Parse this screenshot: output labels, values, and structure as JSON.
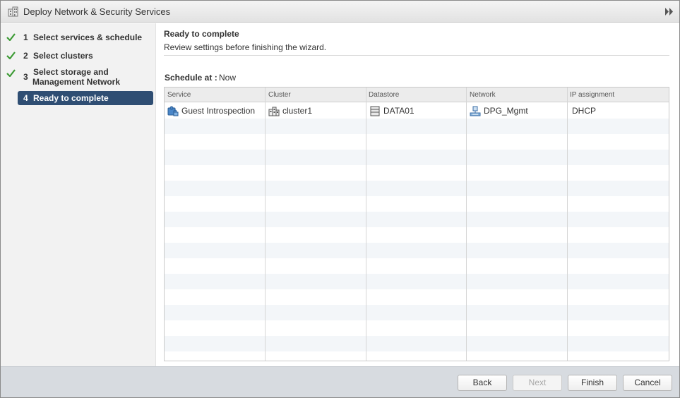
{
  "window": {
    "title": "Deploy Network & Security Services",
    "title_icon": "building-icon",
    "expand_icon": "double-chevron-right-icon"
  },
  "steps": [
    {
      "num": "1",
      "label": "Select services & schedule",
      "done": true
    },
    {
      "num": "2",
      "label": "Select clusters",
      "done": true
    },
    {
      "num": "3",
      "label": "Select storage and",
      "label2": "Management Network",
      "done": true
    },
    {
      "num": "4",
      "label": "Ready to complete",
      "done": false,
      "active": true
    }
  ],
  "page": {
    "title": "Ready to complete",
    "subtitle": "Review settings before finishing the wizard.",
    "schedule_label": "Schedule at :",
    "schedule_value": "Now"
  },
  "table": {
    "columns": [
      "Service",
      "Cluster",
      "Datastore",
      "Network",
      "IP assignment"
    ],
    "rows": [
      {
        "service": "Guest Introspection",
        "cluster": "cluster1",
        "datastore": "DATA01",
        "network": "DPG_Mgmt",
        "ip": "DHCP"
      }
    ]
  },
  "buttons": {
    "back": "Back",
    "next": "Next",
    "finish": "Finish",
    "cancel": "Cancel"
  },
  "colors": {
    "active_step_bg": "#2f4e73",
    "check_green": "#3d9b35",
    "row_stripe": "#f3f6f9"
  }
}
